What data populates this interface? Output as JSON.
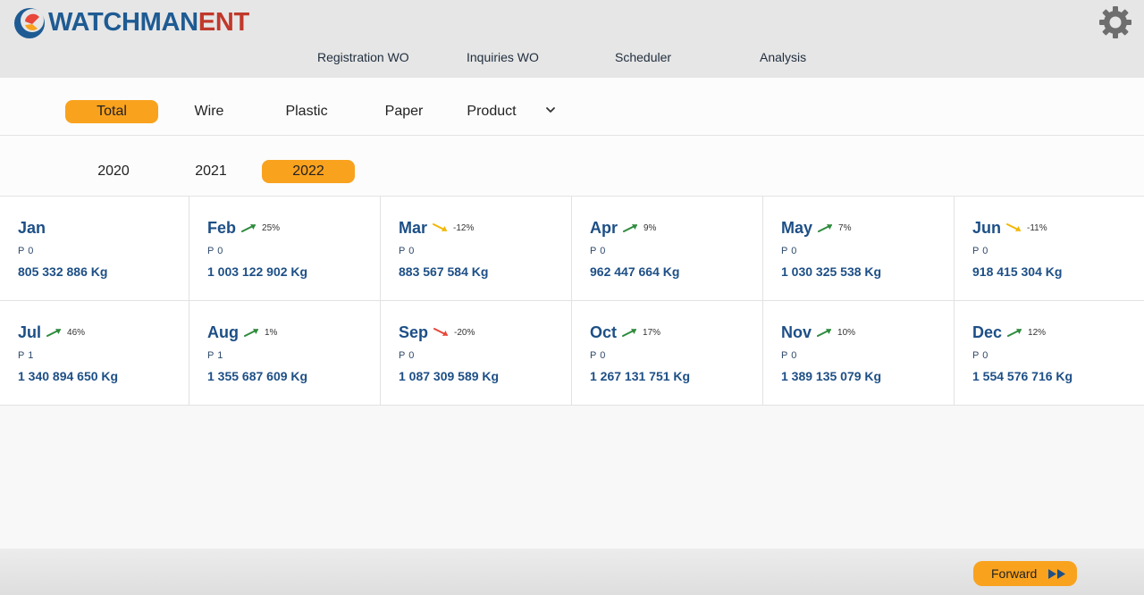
{
  "app": {
    "brand_part1": "WATCHMAN",
    "brand_part2": "ENT"
  },
  "nav": [
    {
      "label": "Registration WO"
    },
    {
      "label": "Inquiries WO"
    },
    {
      "label": "Scheduler"
    },
    {
      "label": "Analysis"
    }
  ],
  "filters": {
    "materials": [
      "Total",
      "Wire",
      "Plastic",
      "Paper",
      "Product"
    ],
    "active_material": "Total",
    "years": [
      "2020",
      "2021",
      "2022"
    ],
    "active_year": "2022"
  },
  "months": [
    {
      "name": "Jan",
      "trend": "none",
      "pct": "",
      "p": "P 0",
      "kg": "805 332 886 Kg"
    },
    {
      "name": "Feb",
      "trend": "up",
      "pct": "25%",
      "p": "P 0",
      "kg": "1 003 122 902 Kg"
    },
    {
      "name": "Mar",
      "trend": "down-mild",
      "pct": "-12%",
      "p": "P 0",
      "kg": "883 567 584 Kg"
    },
    {
      "name": "Apr",
      "trend": "up",
      "pct": "9%",
      "p": "P 0",
      "kg": "962 447 664 Kg"
    },
    {
      "name": "May",
      "trend": "up",
      "pct": "7%",
      "p": "P 0",
      "kg": "1 030 325 538 Kg"
    },
    {
      "name": "Jun",
      "trend": "down-mild",
      "pct": "-11%",
      "p": "P 0",
      "kg": "918 415 304 Kg"
    },
    {
      "name": "Jul",
      "trend": "up",
      "pct": "46%",
      "p": "P 1",
      "kg": "1 340 894 650 Kg"
    },
    {
      "name": "Aug",
      "trend": "up",
      "pct": "1%",
      "p": "P 1",
      "kg": "1 355 687 609 Kg"
    },
    {
      "name": "Sep",
      "trend": "down-strong",
      "pct": "-20%",
      "p": "P 0",
      "kg": "1 087 309 589 Kg"
    },
    {
      "name": "Oct",
      "trend": "up",
      "pct": "17%",
      "p": "P 0",
      "kg": "1 267 131 751 Kg"
    },
    {
      "name": "Nov",
      "trend": "up",
      "pct": "10%",
      "p": "P 0",
      "kg": "1 389 135 079 Kg"
    },
    {
      "name": "Dec",
      "trend": "up",
      "pct": "12%",
      "p": "P 0",
      "kg": "1 554 576 716 Kg"
    }
  ],
  "trend_colors": {
    "up": "#2e8b3d",
    "down-mild": "#f2b705",
    "down-strong": "#e8473a"
  },
  "accent": "#f9a21e",
  "icons": {
    "settings": "gear-icon",
    "dropdown": "chevron-down-icon",
    "forward": "fast-forward-icon"
  },
  "footer": {
    "forward_label": "Forward"
  }
}
